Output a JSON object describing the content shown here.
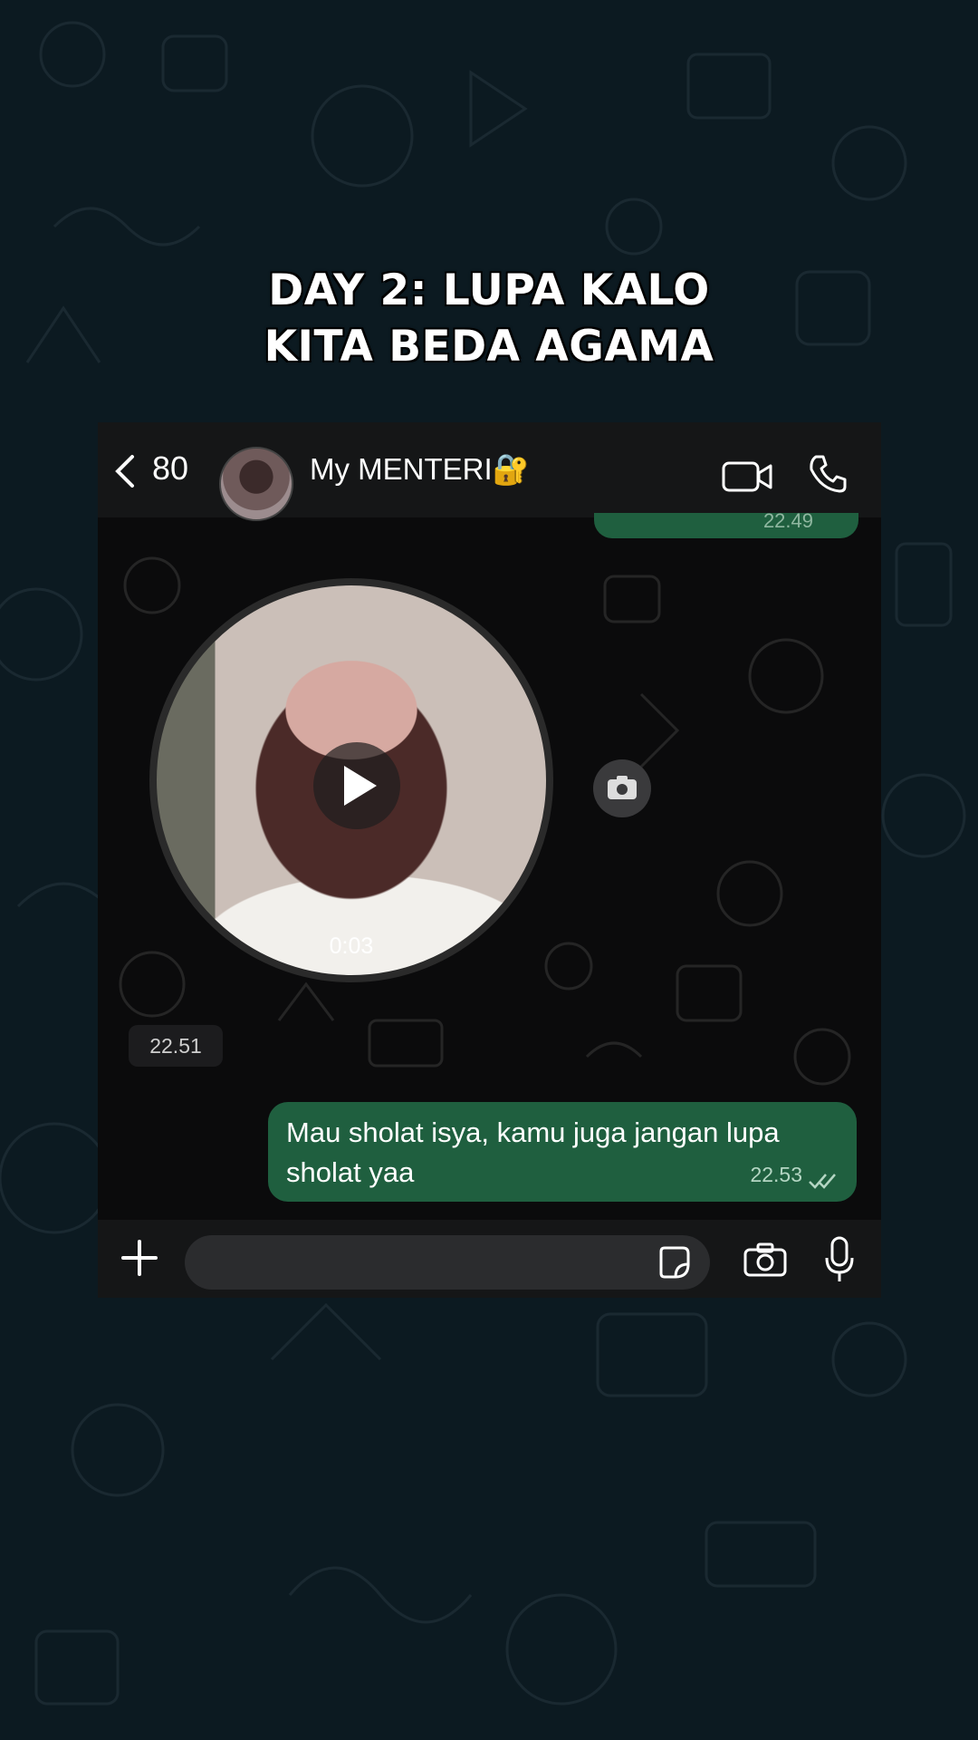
{
  "overlay": {
    "line1": "DAY 2: LUPA KALO",
    "line2": "KITA BEDA AGAMA"
  },
  "header": {
    "unread_count": "80",
    "contact_name": "My MENTERI🔐"
  },
  "messages": {
    "prev_time": "22.49",
    "video_note": {
      "duration": "0:03"
    },
    "separator_time": "22.51",
    "outgoing": {
      "text": "Mau sholat isya, kamu juga jangan lupa sholat yaa",
      "time": "22.53",
      "status": "read"
    }
  },
  "composer": {
    "placeholder": ""
  },
  "colors": {
    "outgoing_bubble": "#1f5f3f",
    "bar": "#151617",
    "bg": "#0c1a21"
  }
}
